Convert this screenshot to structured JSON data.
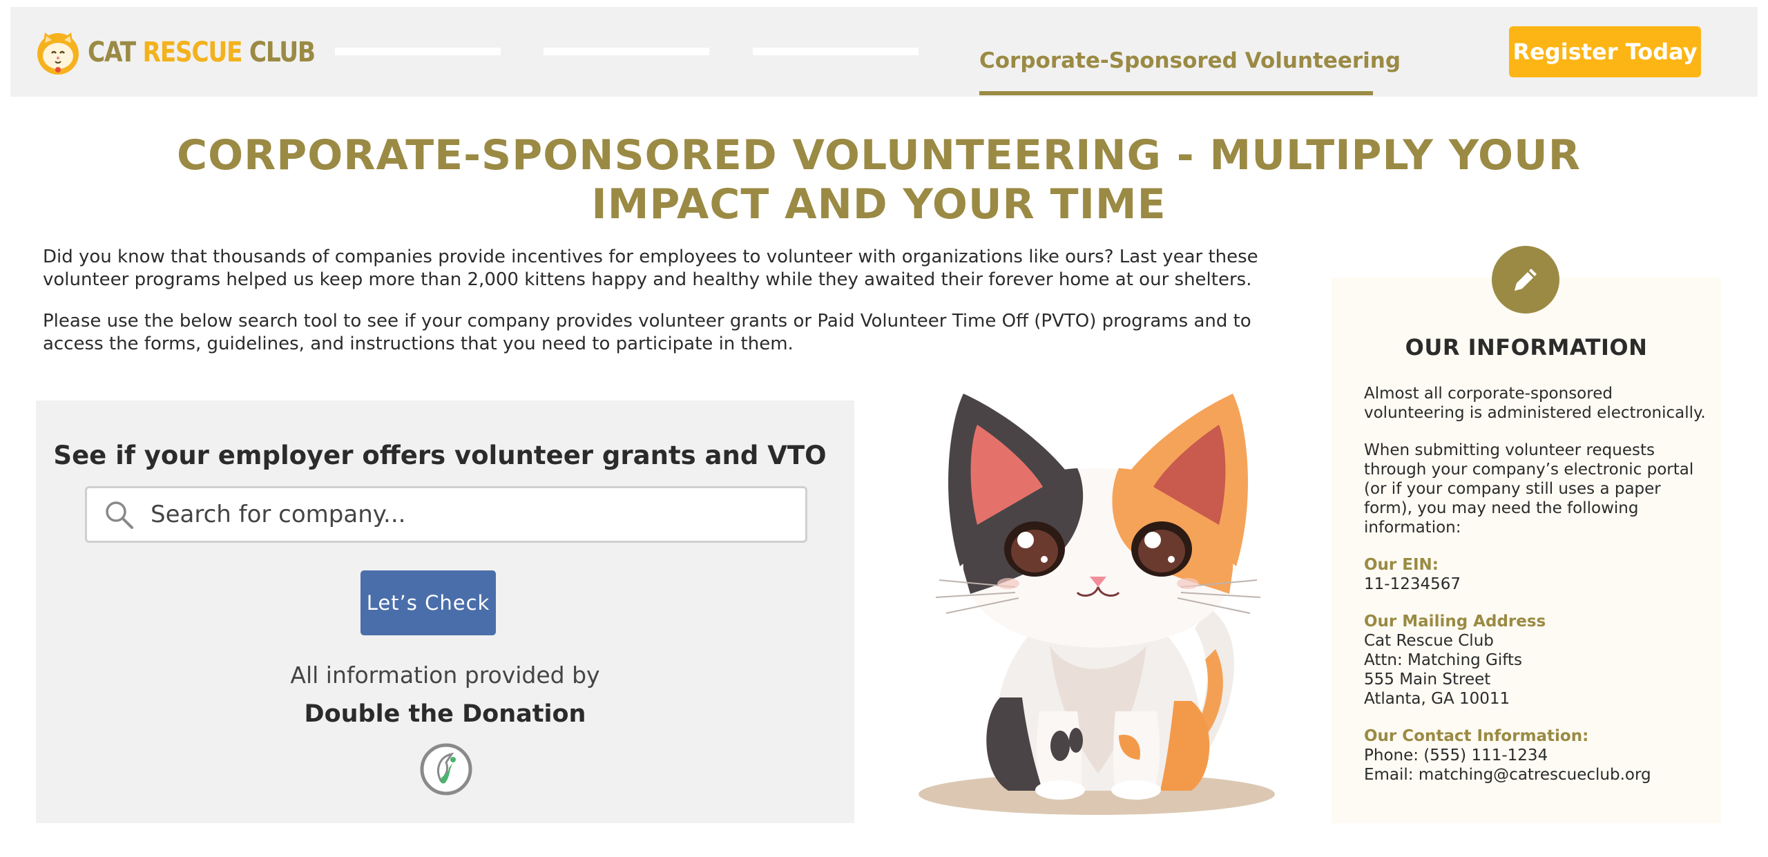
{
  "header": {
    "logo": {
      "word1": "CAT",
      "word2": "RESCUE",
      "word3": "CLUB"
    },
    "nav_active": "Corporate-Sponsored Volunteering",
    "register_label": "Register Today"
  },
  "page": {
    "title_line1": "CORPORATE-SPONSORED VOLUNTEERING - MULTIPLY YOUR",
    "title_line2": "IMPACT AND YOUR TIME",
    "intro_p1": "Did you know that thousands of companies provide incentives for employees to volunteer with organizations like ours? Last year these volunteer programs helped us keep more than 2,000 kittens happy and healthy while they awaited their forever home at our shelters.",
    "intro_p2": "Please use the below search tool to see if your company provides volunteer grants or Paid Volunteer Time Off (PVTO) programs and to access the forms, guidelines, and instructions that you need to participate in them."
  },
  "search": {
    "heading": "See if your employer offers volunteer grants and VTO",
    "placeholder": "Search for company...",
    "button_label": "Let’s Check",
    "provided_by": "All information provided by",
    "provider_name": "Double the Donation"
  },
  "info": {
    "title": "OUR INFORMATION",
    "p1": "Almost all corporate-sponsored volunteering is administered electronically.",
    "p2": "When submitting volunteer requests through your company’s electronic portal (or if your company still uses a paper form), you may need the following information:",
    "ein_label": "Our EIN:",
    "ein_value": "11-1234567",
    "address_label": "Our Mailing Address",
    "address_lines": [
      "Cat Rescue Club",
      "Attn: Matching Gifts",
      "555 Main Street",
      "Atlanta, GA 10011"
    ],
    "contact_label": "Our Contact Information:",
    "phone": "Phone: (555) 111-1234",
    "email": "Email: matching@catrescueclub.org"
  },
  "colors": {
    "brand_olive": "#9a8a44",
    "brand_yellow": "#fdb515",
    "button_blue": "#4a6ea9",
    "panel_gray": "#f1f1f1",
    "card_cream": "#fdfbf3"
  },
  "icons": {
    "logo": "cat-face-icon",
    "search": "magnifier-icon",
    "badge": "pencil-icon",
    "provider": "double-the-donation-logo-icon"
  }
}
